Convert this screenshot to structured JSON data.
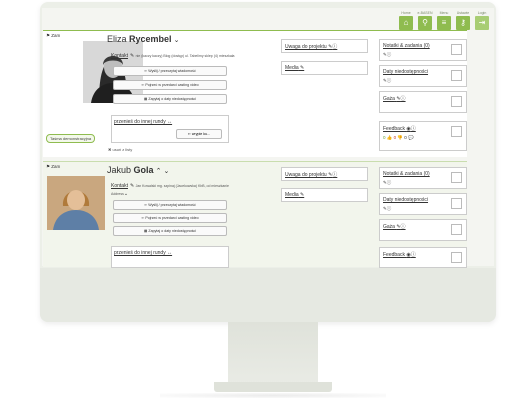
{
  "nav": [
    {
      "label": "Home",
      "icon": "home-icon",
      "glyph": "⌂"
    },
    {
      "label": "e-BASEN",
      "icon": "magnifier-icon",
      "glyph": "⚲"
    },
    {
      "label": "Menu",
      "icon": "menu-icon",
      "glyph": "≡"
    },
    {
      "label": "Ustawie",
      "icon": "key-icon",
      "glyph": "⚷"
    },
    {
      "label": "Login",
      "icon": "exit-icon",
      "glyph": "⇥"
    }
  ],
  "common": {
    "flag": "⚑ Zam",
    "contact": "Kontakt",
    "btn_reply": "⇐ Wyślij / przeczytaj wiadomość",
    "btn_invite": "⇐ Pojrzeć w przedarci casting video",
    "btn_dates": "▦ Zapytaj o daty niedostępności",
    "move": "przenieś do innej rundy ↔",
    "move_btn": "⇐ wrypie ku...",
    "remark": "Uwaga do projektu",
    "media": "Media",
    "notes": "Notatki & zadania (0)",
    "dates": "Daty niedostępności",
    "fee": "Gaża",
    "feedback": "Feedback",
    "feedback_counts": [
      "0 👍",
      "0 👎",
      "0 💬"
    ]
  },
  "row1": {
    "first": "Eliza",
    "last": "Rycembel",
    "contact_info": "nie (kaczy kaczy) Blog (dostęp) ul. Tabelimy sklep (4) mieszkała",
    "demo": "Taśma demonstracyjna",
    "remove": "✖ usuń z listy"
  },
  "row2": {
    "first": "Jakub",
    "last": "Gola",
    "contact_info": "Jan Kowalski mg. szpinaj (Jacekowska) KbB, od mieszkanie",
    "contact_info2": "Address"
  }
}
